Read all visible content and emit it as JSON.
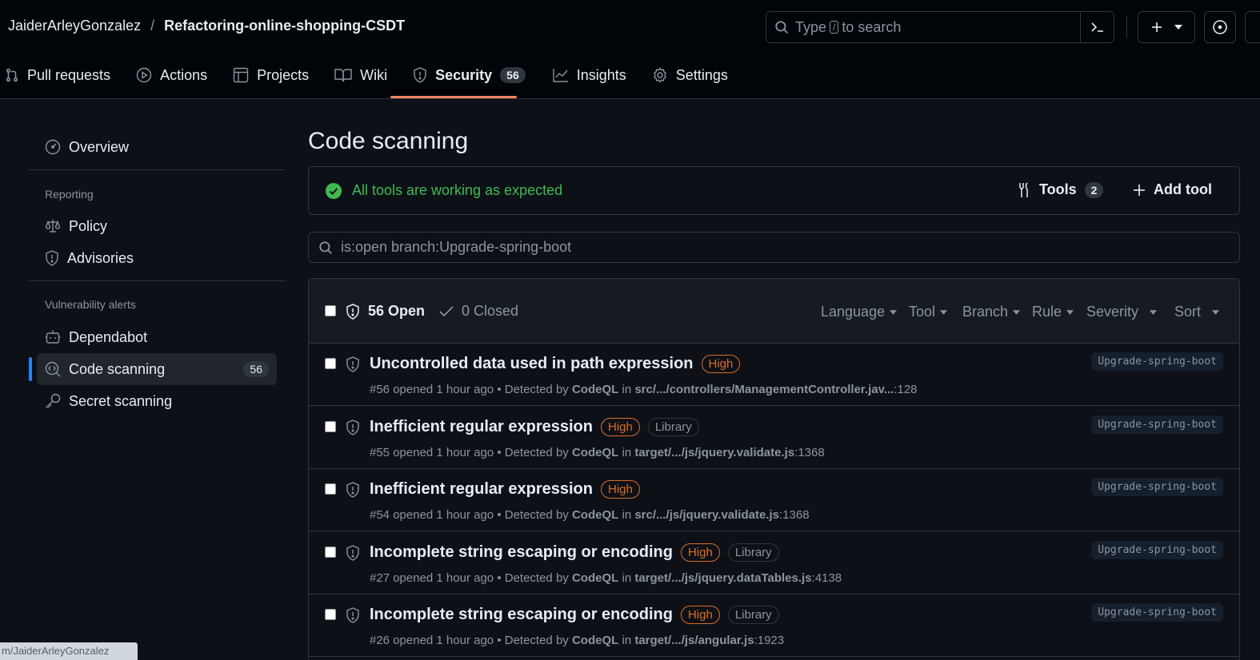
{
  "repo": {
    "owner": "JaiderArleyGonzalez",
    "separator": "/",
    "name": "Refactoring-online-shopping-CSDT"
  },
  "search": {
    "prefix": "Type",
    "key": "/",
    "suffix": "to search"
  },
  "tabs": [
    {
      "label": "Pull requests",
      "icon": "pull-request-icon"
    },
    {
      "label": "Actions",
      "icon": "play-icon"
    },
    {
      "label": "Projects",
      "icon": "table-icon"
    },
    {
      "label": "Wiki",
      "icon": "book-icon"
    },
    {
      "label": "Security",
      "icon": "shield-icon",
      "count": "56",
      "active": true
    },
    {
      "label": "Insights",
      "icon": "graph-icon"
    },
    {
      "label": "Settings",
      "icon": "gear-icon"
    }
  ],
  "sidebar": {
    "overview": "Overview",
    "reporting_heading": "Reporting",
    "policy": "Policy",
    "advisories": "Advisories",
    "vuln_heading": "Vulnerability alerts",
    "dependabot": "Dependabot",
    "code_scanning": "Code scanning",
    "code_scanning_count": "56",
    "secret_scanning": "Secret scanning"
  },
  "main": {
    "title": "Code scanning",
    "status": "All tools are working as expected",
    "tools_label": "Tools",
    "tools_count": "2",
    "add_tool": "Add tool",
    "filter_value": "is:open branch:Upgrade-spring-boot"
  },
  "list_header": {
    "open": "56 Open",
    "closed": "0 Closed",
    "filters": [
      "Language",
      "Tool",
      "Branch",
      "Rule",
      "Severity",
      "Sort"
    ]
  },
  "alerts": [
    {
      "title": "Uncontrolled data used in path expression",
      "severity": "High",
      "library": "",
      "number": "#56",
      "opened": "opened 1 hour ago • Detected by",
      "tool": "CodeQL",
      "in": "in",
      "path": "src/.../controllers/ManagementController.jav...",
      "line": ":128",
      "branch": "Upgrade-spring-boot"
    },
    {
      "title": "Inefficient regular expression",
      "severity": "High",
      "library": "Library",
      "number": "#55",
      "opened": "opened 1 hour ago • Detected by",
      "tool": "CodeQL",
      "in": "in",
      "path": "target/.../js/jquery.validate.js",
      "line": ":1368",
      "branch": "Upgrade-spring-boot"
    },
    {
      "title": "Inefficient regular expression",
      "severity": "High",
      "library": "",
      "number": "#54",
      "opened": "opened 1 hour ago • Detected by",
      "tool": "CodeQL",
      "in": "in",
      "path": "src/.../js/jquery.validate.js",
      "line": ":1368",
      "branch": "Upgrade-spring-boot"
    },
    {
      "title": "Incomplete string escaping or encoding",
      "severity": "High",
      "library": "Library",
      "number": "#27",
      "opened": "opened 1 hour ago • Detected by",
      "tool": "CodeQL",
      "in": "in",
      "path": "target/.../js/jquery.dataTables.js",
      "line": ":4138",
      "branch": "Upgrade-spring-boot"
    },
    {
      "title": "Incomplete string escaping or encoding",
      "severity": "High",
      "library": "Library",
      "number": "#26",
      "opened": "opened 1 hour ago • Detected by",
      "tool": "CodeQL",
      "in": "in",
      "path": "target/.../js/angular.js",
      "line": ":1923",
      "branch": "Upgrade-spring-boot"
    }
  ],
  "statusbar": "m/JaiderArleyGonzalez",
  "colors": {
    "accent": "#f78166",
    "success": "#3fb950",
    "high": "#db6d28",
    "active_bar": "#2f81f7"
  }
}
